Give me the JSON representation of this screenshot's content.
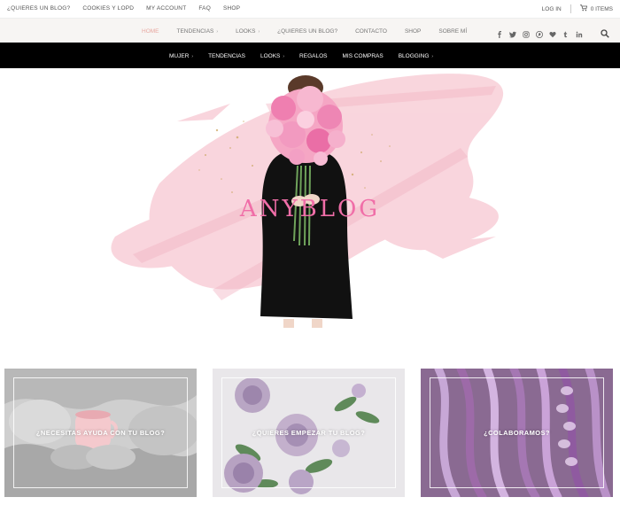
{
  "topbar": {
    "links": [
      "¿QUIERES UN BLOG?",
      "COOKIES Y LOPD",
      "MY ACCOUNT",
      "FAQ",
      "SHOP"
    ],
    "login": "LOG IN",
    "cart": "0 ITEMS"
  },
  "nav1": {
    "items": [
      {
        "label": "HOME",
        "active": true,
        "dropdown": false
      },
      {
        "label": "TENDENCIAS",
        "active": false,
        "dropdown": true
      },
      {
        "label": "LOOKS",
        "active": false,
        "dropdown": true
      },
      {
        "label": "¿QUIERES UN BLOG?",
        "active": false,
        "dropdown": false
      },
      {
        "label": "CONTACTO",
        "active": false,
        "dropdown": false
      },
      {
        "label": "SHOP",
        "active": false,
        "dropdown": false
      },
      {
        "label": "SOBRE MÍ",
        "active": false,
        "dropdown": false
      }
    ],
    "social": [
      "facebook-icon",
      "twitter-icon",
      "instagram-icon",
      "pinterest-icon",
      "heart-icon",
      "tumblr-icon",
      "linkedin-icon"
    ]
  },
  "nav2": {
    "items": [
      {
        "label": "MUJER",
        "dropdown": true
      },
      {
        "label": "TENDENCIAS",
        "dropdown": false
      },
      {
        "label": "LOOKS",
        "dropdown": true
      },
      {
        "label": "REGALOS",
        "dropdown": false
      },
      {
        "label": "MIS COMPRAS",
        "dropdown": false
      },
      {
        "label": "BLOGGING",
        "dropdown": true
      }
    ]
  },
  "hero": {
    "logo": "ANYBLOG",
    "colors": {
      "pink": "#f06ea8",
      "wash": "#f7c8d2",
      "gold": "#c9a25a"
    }
  },
  "cards": [
    {
      "label": "¿NECESITAS AYUDA CON TU BLOG?"
    },
    {
      "label": "¿QUIERES EMPEZAR TU BLOG?"
    },
    {
      "label": "¿COLABORAMOS?"
    }
  ]
}
